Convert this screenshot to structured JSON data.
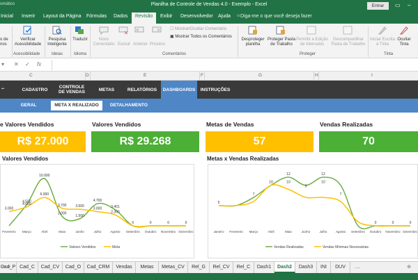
{
  "window": {
    "autosave_fragment": "omático",
    "title": "Planilha de Controle de Vendas 4.0 - Exemplo  -  Excel",
    "signin_label": "Entrar"
  },
  "ribbon_tabs": [
    "Inicial",
    "Inserir",
    "Layout da Página",
    "Fórmulas",
    "Dados",
    "Revisão",
    "Exibir",
    "Desenvolvedor",
    "Ajuda"
  ],
  "tell_me": "Diga-me o que você deseja fazer",
  "ribbon": {
    "partial_left": "o de\nnos",
    "verificar": "Verificar\nAcessibilidade",
    "pesquisa": "Pesquisa\nInteligente",
    "traduzir": "Traduzir",
    "novo_comentario": "Novo\nComentário",
    "excluir": "Excluir",
    "anterior": "Anterior",
    "proximo": "Próximo",
    "mostrar_ocultar": "Mostrar/Ocultar Comentário",
    "mostrar_todos": "Mostrar Todos os Comentários",
    "desproteger_planilha": "Desproteger\nplanilha",
    "proteger_pasta": "Proteger Pasta\nde Trabalho",
    "permitir_edicao": "Permitir a Edição\nde Intervalos",
    "descompartilhar": "Descompartilhar\nPasta de Trabalho",
    "iniciar_escrita": "Iniciar Escrita\nà Tinta",
    "ocultar_tinta": "Ocultar\nTinta",
    "groups": {
      "acessibilidade": "Acessibilidade",
      "ideias": "Ideias",
      "idioma": "Idioma",
      "comentarios": "Comentários",
      "proteger": "Proteger",
      "tinta": "Tinta"
    }
  },
  "formula_bar": {
    "cancel": "✕",
    "enter": "✓",
    "fx": "fx",
    "value": ""
  },
  "columns": [
    "C",
    "D",
    "E",
    "F",
    "G",
    "H",
    "I"
  ],
  "nav": {
    "items": [
      "CADASTRO",
      "CONTROLE\nDE VENDAS",
      "METAS",
      "RELATÓRIOS",
      "DASHBOARDS",
      "INSTRUÇÕES"
    ],
    "active": "DASHBOARDS"
  },
  "subnav": {
    "items": [
      "GERAL",
      "META X REALIZADO",
      "DETALHAMENTO"
    ],
    "active": "META X REALIZADO"
  },
  "kpis": [
    {
      "title": "e Valores Vendidos",
      "value": "R$ 27.000",
      "color": "#ffc000"
    },
    {
      "title": "Valores Vendidos",
      "value": "R$ 29.268",
      "color": "#4caf36"
    },
    {
      "title": "Metas de Vendas",
      "value": "57",
      "color": "#ffc000"
    },
    {
      "title": "Vendas Realizadas",
      "value": "70",
      "color": "#4caf36"
    }
  ],
  "sections": {
    "left_title": "Valores Vendidos",
    "right_title": "Metas x Vendas Realizadas"
  },
  "colors": {
    "excel_green": "#217346",
    "nav_dark": "#3a3a3a",
    "nav_blue": "#4f86c6",
    "kpi_yellow": "#ffc000",
    "kpi_green": "#4caf36",
    "series_green": "#70ad47",
    "series_yellow": "#ffc000"
  },
  "chart_data": [
    {
      "type": "line",
      "title": "Valores Vendidos",
      "categories": [
        "Fevereiro",
        "Março",
        "Abril",
        "Maio",
        "Junho",
        "Julho",
        "Agosto",
        "Setembro",
        "Outubro",
        "Novembro",
        "Dezembro"
      ],
      "series": [
        {
          "name": "Valores Vendidos",
          "color": "#70ad47",
          "values": [
            0,
            4500,
            10000,
            2000,
            1500,
            4700,
            3401,
            0,
            0,
            0,
            0
          ]
        },
        {
          "name": "Meta",
          "color": "#ffc000",
          "values": [
            3000,
            4000,
            6000,
            3700,
            3500,
            3000,
            2300,
            0,
            0,
            0,
            0
          ]
        }
      ],
      "data_labels": [
        {
          "text": "3.000",
          "cat": 0,
          "value": 3000
        },
        {
          "text": "4.500",
          "cat": 1,
          "value": 4500
        },
        {
          "text": "4.000",
          "cat": 1,
          "value": 4000
        },
        {
          "text": "10.000",
          "cat": 2,
          "value": 10000
        },
        {
          "text": "6.000",
          "cat": 2,
          "value": 6000
        },
        {
          "text": "3.700",
          "cat": 3,
          "value": 3700
        },
        {
          "text": "2.000",
          "cat": 3,
          "value": 2000
        },
        {
          "text": "3.500",
          "cat": 4,
          "value": 3500
        },
        {
          "text": "1.500",
          "cat": 4,
          "value": 1500
        },
        {
          "text": "4.700",
          "cat": 5,
          "value": 4700
        },
        {
          "text": "3.000",
          "cat": 5,
          "value": 3000
        },
        {
          "text": "3.401",
          "cat": 6,
          "value": 3401
        },
        {
          "text": "2.300",
          "cat": 6,
          "value": 2300
        },
        {
          "text": "0",
          "cat": 7,
          "value": 0
        },
        {
          "text": "0",
          "cat": 8,
          "value": 0
        },
        {
          "text": "0",
          "cat": 9,
          "value": 0
        },
        {
          "text": "0",
          "cat": 10,
          "value": 0
        }
      ],
      "ylim": [
        0,
        10000
      ],
      "legend": "bottom"
    },
    {
      "type": "line",
      "title": "Metas x Vendas Realizadas",
      "categories": [
        "Janeiro",
        "Fevereiro",
        "Março",
        "Abril",
        "Maio",
        "Junho",
        "Julho",
        "Agosto",
        "Setembro",
        "Outubro",
        "Novembro",
        "Dezembro"
      ],
      "series": [
        {
          "name": "Vendas Realizadas",
          "color": "#70ad47",
          "values": [
            5,
            5,
            7,
            10,
            12,
            10,
            12,
            10,
            0,
            0,
            0,
            0
          ]
        },
        {
          "name": "Vendas Mínimas Necessárias",
          "color": "#ffc000",
          "values": [
            5,
            5,
            6,
            10,
            9,
            7,
            7,
            6,
            1,
            0,
            0,
            0
          ]
        }
      ],
      "data_labels": [
        {
          "text": "5",
          "cat": 0,
          "value": 5
        },
        {
          "text": "7",
          "cat": 2,
          "value": 7
        },
        {
          "text": "10",
          "cat": 3,
          "value": 10
        },
        {
          "text": "12",
          "cat": 4,
          "value": 12
        },
        {
          "text": "10",
          "cat": 4,
          "value": 10
        },
        {
          "text": "9",
          "cat": 5,
          "value": 9
        },
        {
          "text": "12",
          "cat": 6,
          "value": 12
        },
        {
          "text": "10",
          "cat": 6,
          "value": 10
        },
        {
          "text": "7",
          "cat": 7,
          "value": 7
        },
        {
          "text": "0",
          "cat": 9,
          "value": 0
        },
        {
          "text": "0",
          "cat": 10,
          "value": 0
        },
        {
          "text": "0",
          "cat": 11,
          "value": 0
        }
      ],
      "ylim": [
        0,
        12
      ],
      "legend": "bottom"
    }
  ],
  "sheet_tabs": [
    "Cad_P",
    "Cad_C",
    "Cad_CV",
    "Cad_O",
    "Cad_CRM",
    "Vendas",
    "Metas",
    "Metas_CV",
    "Rel_G",
    "Rel_CV",
    "Rel_C",
    "Dash1",
    "Dash2",
    "Dash3",
    "INI",
    "DUV"
  ],
  "active_sheet": "Dash2"
}
